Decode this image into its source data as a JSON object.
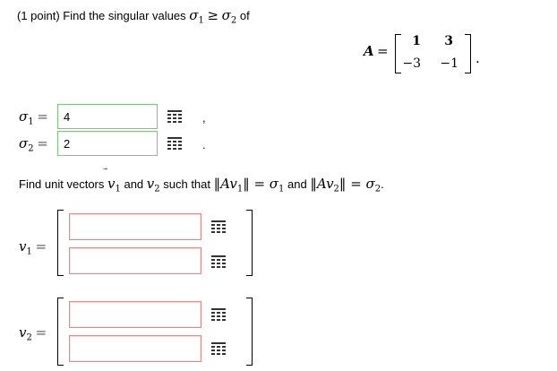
{
  "header": {
    "prefix": "(1 point) Find the singular values ",
    "sigma1": "σ",
    "sub1": "1",
    "geq": "≥",
    "sigma2": "σ",
    "sub2": "2",
    "suffix": " of"
  },
  "matrix": {
    "name": "A",
    "eq": "=",
    "cells": [
      "1",
      "3",
      "−3",
      "−1"
    ],
    "period": "."
  },
  "singular_values": [
    {
      "symbol": "σ",
      "sub": "1",
      "eq": "=",
      "value": "4",
      "after": ","
    },
    {
      "symbol": "σ",
      "sub": "2",
      "eq": "=",
      "value": "2",
      "after": "."
    }
  ],
  "question": {
    "p1": "Find unit vectors ",
    "v1": "v",
    "v1sub": "1",
    "and1": " and ",
    "v2": "v",
    "v2sub": "2",
    "p2": " such that ",
    "norm1": "‖Av",
    "norm1sub": "1",
    "norm1end": "‖ = σ",
    "sig1sub": "1",
    "and2": " and ",
    "norm2": "‖Av",
    "norm2sub": "2",
    "norm2end": "‖ = σ",
    "sig2sub": "2",
    "end": "."
  },
  "vectors": [
    {
      "symbol": "v",
      "sub": "1",
      "eq": "=",
      "entries": [
        "",
        ""
      ]
    },
    {
      "symbol": "v",
      "sub": "2",
      "eq": "=",
      "entries": [
        "",
        ""
      ]
    }
  ],
  "colors": {
    "correct_border": "#7cc57c",
    "empty_border": "#e08a8a",
    "icon": "#333333"
  },
  "icons": {
    "entry_tool": "grid-icon"
  }
}
